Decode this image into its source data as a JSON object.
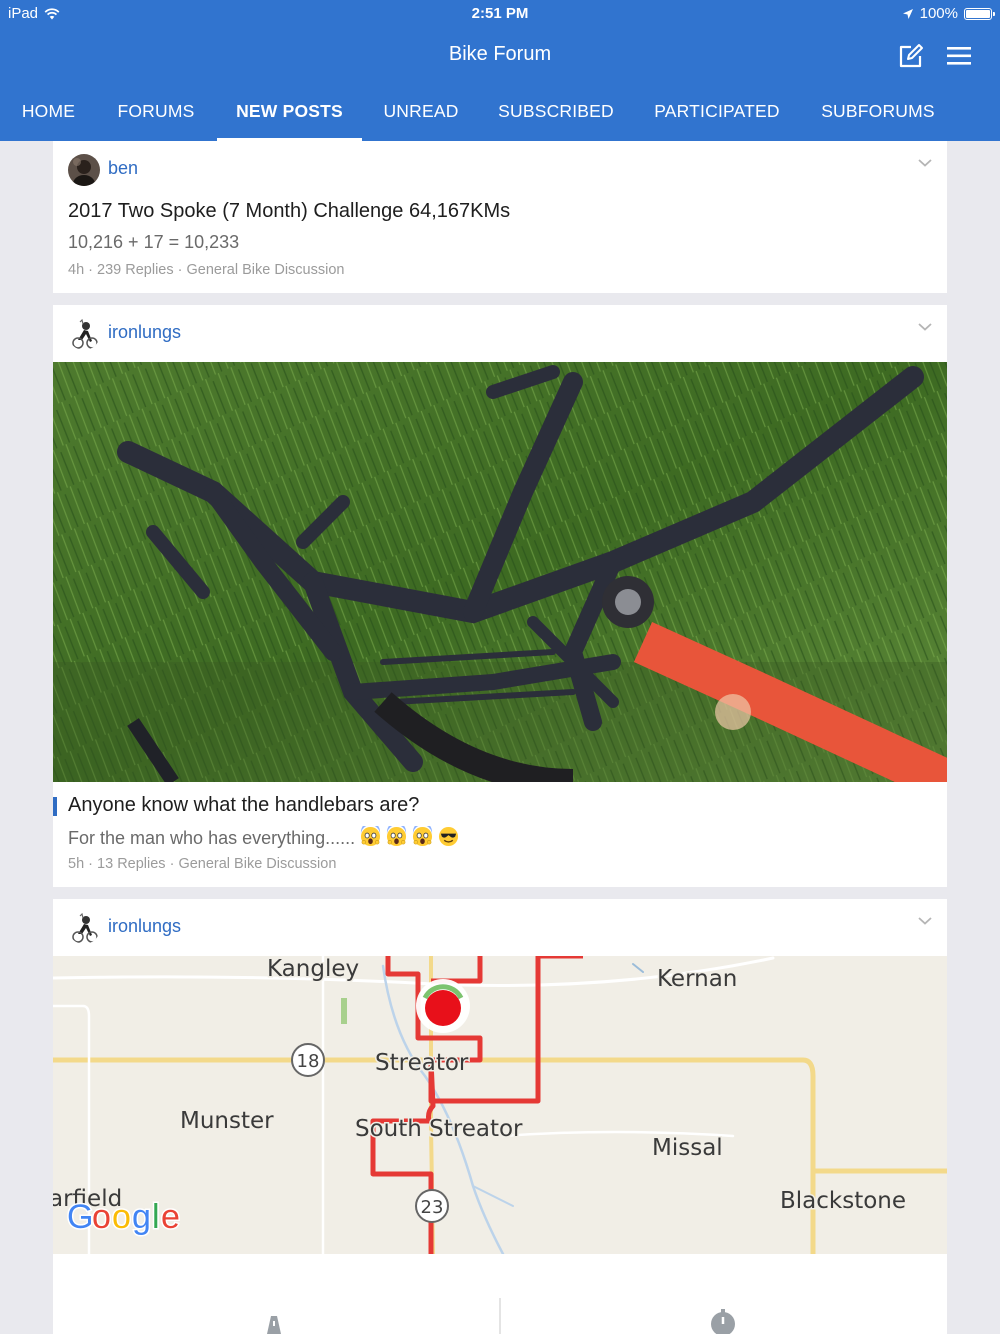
{
  "status_bar": {
    "device": "iPad",
    "time": "2:51 PM",
    "battery": "100%",
    "battery_level": 1.0
  },
  "app": {
    "title": "Bike Forum",
    "compose_icon": "compose-icon",
    "menu_icon": "hamburger-menu-icon"
  },
  "tabs": [
    {
      "label": "HOME",
      "active": false
    },
    {
      "label": "FORUMS",
      "active": false
    },
    {
      "label": "NEW POSTS",
      "active": true
    },
    {
      "label": "UNREAD",
      "active": false
    },
    {
      "label": "SUBSCRIBED",
      "active": false
    },
    {
      "label": "PARTICIPATED",
      "active": false
    },
    {
      "label": "SUBFORUMS",
      "active": false
    }
  ],
  "posts": [
    {
      "username": "ben",
      "title": "2017 Two Spoke (7 Month) Challenge 64,167KMs",
      "body": "10,216 + 17 = 10,233",
      "age": "4h",
      "replies": "239 Replies",
      "forum": "General Bike Discussion"
    },
    {
      "username": "ironlungs",
      "title": "Anyone know what the handlebars are?",
      "body": "For the man who has everything......",
      "age": "5h",
      "replies": "13 Replies",
      "forum": "General Bike Discussion",
      "emojis": [
        "face-screaming-icon",
        "face-screaming-icon",
        "face-screaming-icon",
        "smiling-face-sunglasses-icon"
      ]
    },
    {
      "username": "ironlungs",
      "map_labels": {
        "kangley": "Kangley",
        "kernan": "Kernan",
        "streator": "Streator",
        "south_streator": "South Streator",
        "munster": "Munster",
        "missal": "Missal",
        "garfield": "arfield",
        "blackstone": "Blackstone",
        "route_18": "18",
        "route_23": "23",
        "google": "Google"
      }
    }
  ],
  "colors": {
    "header": "#3174cf",
    "link": "#2f6cc3",
    "route": "#e53935"
  }
}
